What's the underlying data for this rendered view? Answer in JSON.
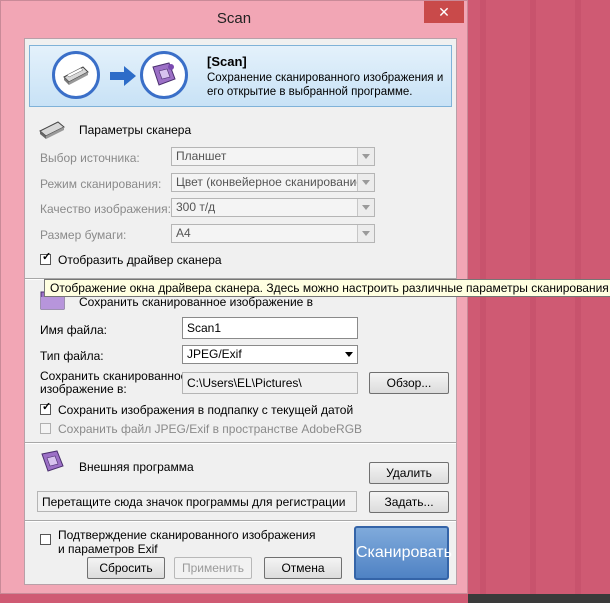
{
  "window": {
    "title": "Scan",
    "close_glyph": "✕"
  },
  "banner": {
    "title": "[Scan]",
    "description": "Сохранение сканированного изображения и его открытие в выбранной программе."
  },
  "scanner_section": {
    "title": "Параметры сканера",
    "source_label": "Выбор источника:",
    "source_value": "Планшет",
    "mode_label": "Режим сканирования:",
    "mode_value": "Цвет (конвейерное сканирование)",
    "quality_label": "Качество изображения:",
    "quality_value": "300 т/д",
    "paper_label": "Размер бумаги:",
    "paper_value": "A4",
    "show_driver_label": "Отобразить драйвер сканера",
    "show_driver_checked": true
  },
  "tooltip": "Отображение окна драйвера сканера. Здесь можно настроить различные параметры сканирования",
  "save_section": {
    "title": "Сохранить сканированное изображение в",
    "filename_label": "Имя файла:",
    "filename_value": "Scan1",
    "filetype_label": "Тип файла:",
    "filetype_value": "JPEG/Exif",
    "path_label_line1": "Сохранить сканированное",
    "path_label_line2": "изображение в:",
    "path_value": "C:\\Users\\EL\\Pictures\\",
    "browse_label": "Обзор...",
    "subfolder_label": "Сохранить изображения в подпапку с текущей датой",
    "subfolder_checked": true,
    "adobergb_label": "Сохранить файл JPEG/Exif в пространстве AdobeRGB",
    "adobergb_checked": false
  },
  "external_section": {
    "title": "Внешняя программа",
    "delete_label": "Удалить",
    "drop_hint": "Перетащите сюда значок программы для регистрации",
    "set_label": "Задать..."
  },
  "footer": {
    "confirm_line1": "Подтверждение сканированного изображения",
    "confirm_line2": "и параметров Exif",
    "confirm_checked": false,
    "reset_label": "Сбросить",
    "apply_label": "Применить",
    "cancel_label": "Отмена",
    "scan_label": "Сканировать"
  },
  "colors": {
    "desktop": "#cf5a73",
    "window_frame": "#f2a6b5",
    "close_button": "#c94a4a",
    "scan_button": "#4f82c4",
    "banner_border": "#7fb2d8"
  },
  "icons": {
    "close": "close-icon",
    "scanner": "scanner-icon",
    "arrow": "arrow-right-icon",
    "app": "application-icon",
    "folder": "folder-icon"
  }
}
